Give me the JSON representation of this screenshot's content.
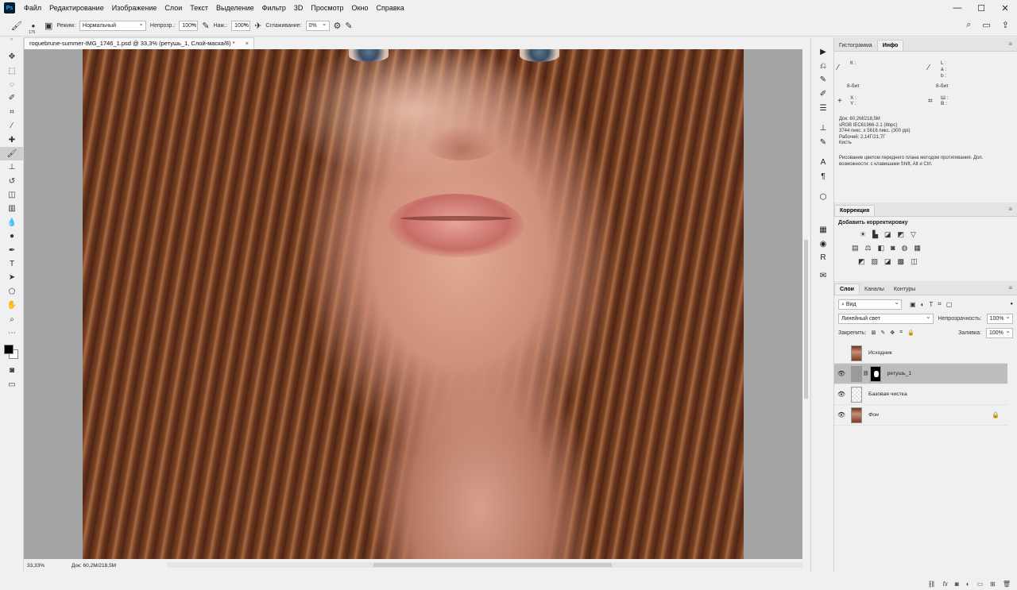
{
  "menu": {
    "app_icon": "Ps",
    "items": [
      "Файл",
      "Редактирование",
      "Изображение",
      "Слои",
      "Текст",
      "Выделение",
      "Фильтр",
      "3D",
      "Просмотр",
      "Окно",
      "Справка"
    ],
    "window_controls": [
      "—",
      "☐",
      "✕"
    ]
  },
  "options": {
    "brush_size": "175",
    "mode_label": "Режим:",
    "mode_value": "Нормальный",
    "opacity_label": "Непрозр.:",
    "opacity_value": "100%",
    "flow_label": "Наж.:",
    "flow_value": "100%",
    "smooth_label": "Сглаживание:",
    "smooth_value": "0%"
  },
  "document": {
    "tab_title": "roquebrune-summer-IMG_1746_1.psd @ 33,3% (ретушь_1, Слой-маска/8) *",
    "close": "×"
  },
  "status": {
    "zoom": "33,33%",
    "doc": "Док: 60,2M/218,5M"
  },
  "info_panel": {
    "tabs": [
      "Гистограмма",
      "Инфо"
    ],
    "active_tab": "Инфо",
    "k_label": "К :",
    "bit_left": "8-бит",
    "l_label": "L :",
    "a_label": "a :",
    "b_label": "b :",
    "bit_right": "8-бит",
    "x_label": "X :",
    "y_label": "Y :",
    "w_label": "Ш :",
    "h_label": "В :",
    "doc_lines": [
      "Док: 60,2M/218,5M",
      "sRGB IEC61966-2.1 (8bpc)",
      "3744 пикс. x 5616 пикс. (300 ppi)",
      "Рабочий: 2,14Г/21,7Г",
      "Кисть"
    ],
    "hint": "Рисование цветом переднего плана методом протягивания. Доп. возможности: с клавишами Shift, Alt и Ctrl."
  },
  "correction_panel": {
    "title": "Коррекция",
    "add_label": "Добавить корректировку"
  },
  "layers_panel": {
    "tabs": [
      "Слои",
      "Каналы",
      "Контуры"
    ],
    "filter": "Вид",
    "blend_mode": "Линейный свет",
    "opacity_label": "Непрозрачность:",
    "opacity_value": "100%",
    "lock_label": "Закрепить:",
    "fill_label": "Заливка:",
    "fill_value": "100%",
    "layers": [
      {
        "name": "Исходник",
        "visible": false,
        "thumb": "face"
      },
      {
        "name": "ретушь_1",
        "visible": true,
        "thumb": "gray",
        "selected": true
      },
      {
        "name": "Базовая чистка",
        "visible": true,
        "thumb": "trans"
      },
      {
        "name": "Фон",
        "visible": true,
        "thumb": "face",
        "locked": true
      }
    ]
  }
}
